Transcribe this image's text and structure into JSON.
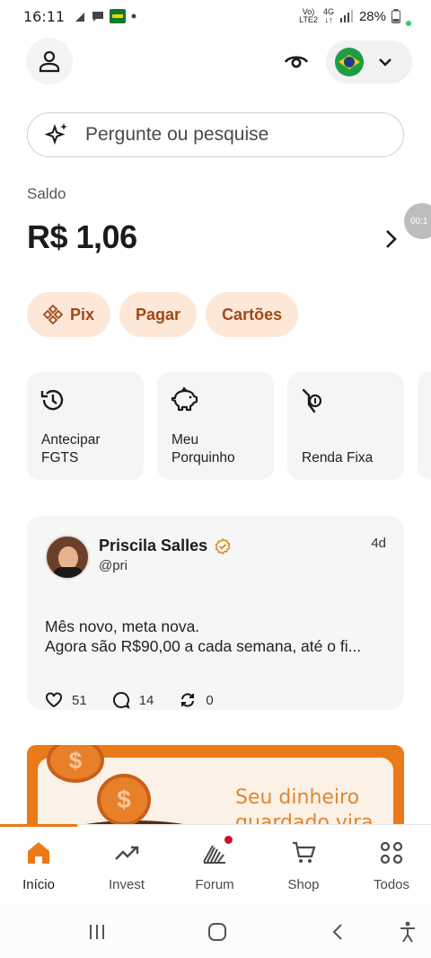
{
  "status_bar": {
    "time": "16:11",
    "network_top": "Vo)",
    "network_bottom": "LTE2",
    "signal_type": "4G",
    "battery": "28%"
  },
  "header": {
    "profile_icon": "user-icon",
    "visibility_icon": "eye-icon",
    "country_flag": "brazil-flag",
    "dropdown_icon": "chevron-down-icon"
  },
  "search": {
    "placeholder": "Pergunte ou pesquise",
    "icon": "sparkles-icon"
  },
  "balance": {
    "label": "Saldo",
    "value": "R$ 1,06",
    "timer": "00:1"
  },
  "quick_chips": [
    {
      "label": "Pix",
      "icon": "pix-icon"
    },
    {
      "label": "Pagar"
    },
    {
      "label": "Cartões"
    }
  ],
  "shortcuts": [
    {
      "label_line1": "Antecipar",
      "label_line2": "FGTS",
      "icon": "history-icon"
    },
    {
      "label_line1": "Meu",
      "label_line2": "Porquinho",
      "icon": "piggy-bank-icon"
    },
    {
      "label_line1": "",
      "label_line2": "Renda Fixa",
      "icon": "hand-coin-icon"
    }
  ],
  "post": {
    "author": "Priscila Salles",
    "handle": "@pri",
    "time": "4d",
    "line1": "Mês novo, meta nova.",
    "line2": "Agora são R$90,00 a cada semana, até o fi...",
    "likes": "51",
    "comments": "14",
    "reposts": "0"
  },
  "banner": {
    "line1": "Seu dinheiro",
    "line2": "guardado vira"
  },
  "tabs": [
    {
      "label": "Início",
      "icon": "home-icon",
      "active": true
    },
    {
      "label": "Invest",
      "icon": "trend-up-icon"
    },
    {
      "label": "Forum",
      "icon": "forum-icon",
      "badge": true
    },
    {
      "label": "Shop",
      "icon": "cart-icon"
    },
    {
      "label": "Todos",
      "icon": "grid-icon"
    }
  ],
  "colors": {
    "accent": "#ea7a17",
    "chip_bg": "#fde8d8",
    "chip_text": "#a0481a",
    "card_bg": "#f5f5f5"
  }
}
